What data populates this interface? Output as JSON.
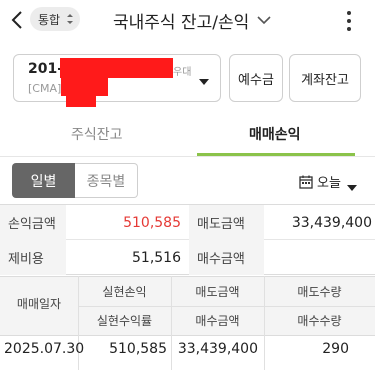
{
  "header": {
    "filter_label": "통합",
    "title": "국내주식 잔고/손익"
  },
  "account": {
    "number_prefix": "201-0",
    "type": "[CMA]",
    "extra": "우대",
    "deposit_button": "예수금",
    "balance_button": "계좌잔고"
  },
  "tabs": [
    {
      "label": "주식잔고",
      "active": false
    },
    {
      "label": "매매손익",
      "active": true
    }
  ],
  "toggle": {
    "daily": "일별",
    "by_item": "종목별"
  },
  "date_picker": {
    "label": "오늘"
  },
  "summary": {
    "rows": [
      {
        "left_label": "손익금액",
        "left_value": "510,585",
        "right_label": "매도금액",
        "right_value": "33,439,400"
      },
      {
        "left_label": "제비용",
        "left_value": "51,516",
        "right_label": "매수금액",
        "right_value": ""
      }
    ]
  },
  "detail": {
    "headers": {
      "date": "매매일자",
      "realized_pnl": "실현손익",
      "realized_rate": "실현수익률",
      "sell_amount": "매도금액",
      "buy_amount": "매수금액",
      "sell_qty": "매도수량",
      "buy_qty": "매수수량"
    },
    "rows": [
      {
        "date": "2025.07.30",
        "realized_pnl": "510,585",
        "sell_amount": "33,439,400",
        "sell_qty": "290"
      }
    ]
  },
  "colors": {
    "accent": "#8bc34a",
    "profit": "#e53935",
    "toggle_active": "#666666"
  }
}
